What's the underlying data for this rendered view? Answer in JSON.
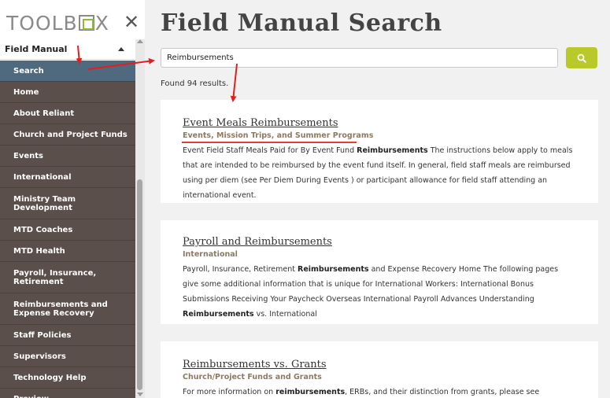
{
  "sidebar": {
    "brand_prefix": "TOOLB",
    "brand_suffix": "X",
    "close_glyph": "✕",
    "section_label": "Field Manual",
    "items": [
      {
        "label": "Search",
        "active": true
      },
      {
        "label": "Home"
      },
      {
        "label": "About Reliant"
      },
      {
        "label": "Church and Project Funds"
      },
      {
        "label": "Events"
      },
      {
        "label": "International"
      },
      {
        "label": "Ministry Team Development"
      },
      {
        "label": "MTD Coaches"
      },
      {
        "label": "MTD Health"
      },
      {
        "label": "Payroll, Insurance, Retirement"
      },
      {
        "label": "Reimbursements and Expense Recovery"
      },
      {
        "label": "Staff Policies"
      },
      {
        "label": "Supervisors"
      },
      {
        "label": "Technology Help"
      },
      {
        "label": "Preview"
      }
    ]
  },
  "main": {
    "title": "Field Manual Search",
    "search_value": "Reimbursements",
    "found_text": "Found 94 results."
  },
  "results": [
    {
      "title": "Event Meals Reimbursements",
      "category": "Events, Mission Trips, and Summer Programs",
      "snippet_html": "Event Field Staff Meals Paid for By Event Fund <b>Reimbursements</b> The instructions below apply to meals that are intended to be reimbursed by the event fund itself. In general, field staff meals are reimbursed using per diem (see Per Diem During Events ) or participant allowance for field staff attending an international event."
    },
    {
      "title": "Payroll and Reimbursements",
      "category": "International",
      "snippet_html": "Payroll, Insurance, Retirement <b>Reimbursements</b> and Expense Recovery Home The following pages give some additional information that is unique for International Workers: International Bonus Submissions Receiving Your Paycheck Overseas International Payroll Advances Understanding <b>Reimbursements</b> vs. International"
    },
    {
      "title": "Reimbursements vs. Grants",
      "category": "Church/Project Funds and Grants",
      "snippet_html": "For more information on <b>reimbursements</b>, ERBs, and their distinction from grants, please see"
    }
  ],
  "colors": {
    "sidebar_bg": "#5a4f4a",
    "active_bg": "#4f6a7f",
    "search_button": "#b9c92a",
    "category_text": "#8d7a60",
    "annotation": "#e0201c"
  },
  "icons": {
    "search_button_icon": "magnifier-icon",
    "close": "close-icon"
  }
}
